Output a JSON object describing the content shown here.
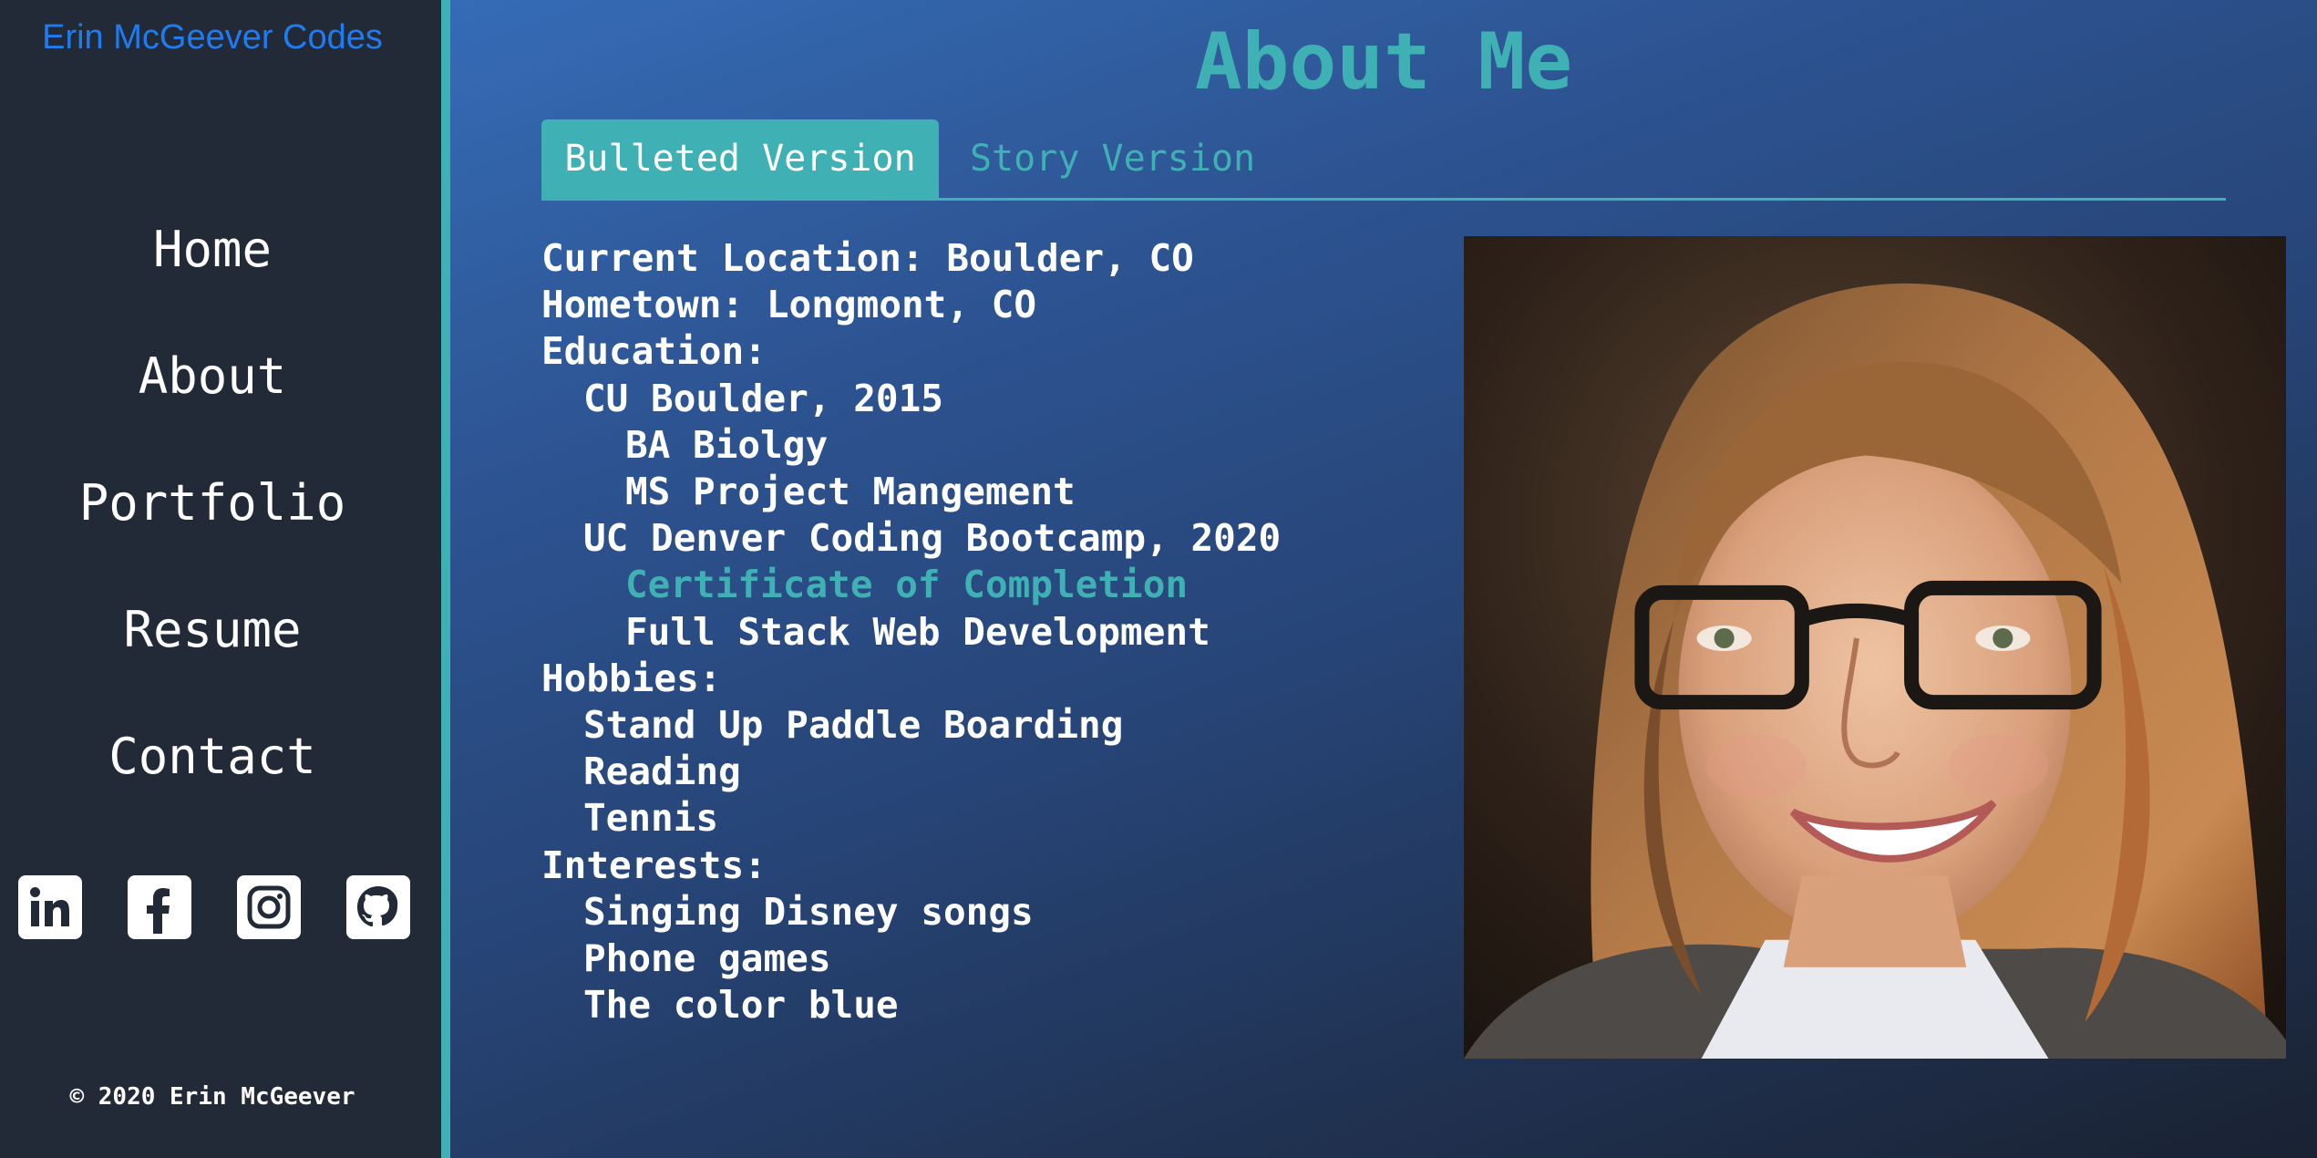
{
  "sidebar": {
    "brand": "Erin McGeever Codes",
    "nav": [
      "Home",
      "About",
      "Portfolio",
      "Resume",
      "Contact"
    ],
    "socials": [
      "linkedin-icon",
      "facebook-icon",
      "instagram-icon",
      "github-icon"
    ],
    "copyright": "© 2020 Erin McGeever"
  },
  "main": {
    "title": "About Me",
    "tabs": [
      {
        "label": "Bulleted Version",
        "active": true
      },
      {
        "label": "Story Version",
        "active": false
      }
    ],
    "details": [
      {
        "text": "Current Location: Boulder, CO",
        "level": 0
      },
      {
        "text": "Hometown: Longmont, CO",
        "level": 0
      },
      {
        "text": "Education:",
        "level": 0
      },
      {
        "text": "CU Boulder, 2015",
        "level": 1
      },
      {
        "text": "BA Biolgy",
        "level": 2
      },
      {
        "text": "MS Project Mangement",
        "level": 2
      },
      {
        "text": "UC Denver Coding Bootcamp, 2020",
        "level": 1
      },
      {
        "text": "Certificate of Completion",
        "level": 2,
        "link": true
      },
      {
        "text": "Full Stack Web Development",
        "level": 2
      },
      {
        "text": "Hobbies:",
        "level": 0
      },
      {
        "text": "Stand Up Paddle Boarding",
        "level": 1
      },
      {
        "text": "Reading",
        "level": 1
      },
      {
        "text": "Tennis",
        "level": 1
      },
      {
        "text": "Interests:",
        "level": 0
      },
      {
        "text": "Singing Disney songs",
        "level": 1
      },
      {
        "text": "Phone games",
        "level": 1
      },
      {
        "text": "The color blue",
        "level": 1
      }
    ]
  },
  "colors": {
    "accent": "#3fb0b3",
    "brand": "#1f7cf0",
    "sidebar_bg": "#232a37"
  }
}
